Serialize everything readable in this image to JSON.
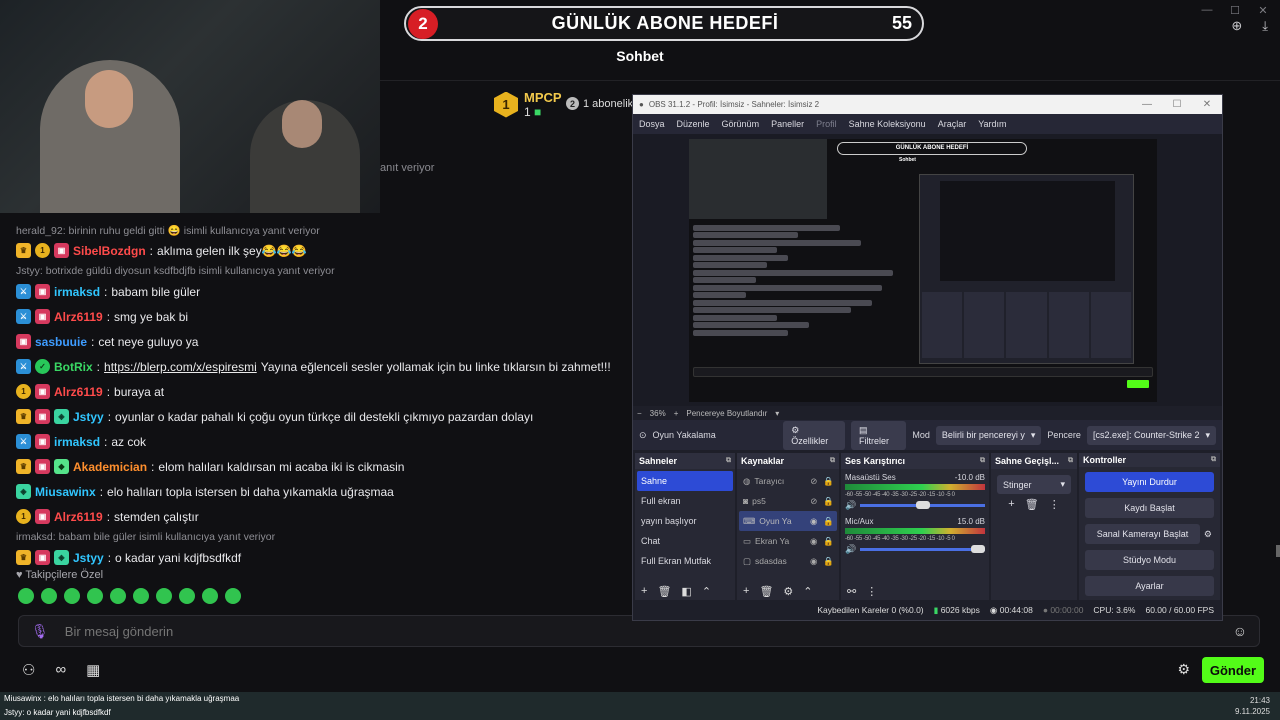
{
  "goal": {
    "badge": "2",
    "title": "GÜNLÜK ABONE HEDEFİ",
    "count": "55"
  },
  "chat_header": "Sohbet",
  "leaderboard": {
    "rank1": "1",
    "rank1_name": "MPCP",
    "rank1_count": "1",
    "rank2": "2",
    "rank2_text": "1 abonelik"
  },
  "partial_reply_text": "anıt veriyor",
  "chat": [
    {
      "type": "reply",
      "text": "herald_92: birinin ruhu geldi gitti 😄 isimli kullanıcıya yanıt veriyor"
    },
    {
      "badges": [
        "crown",
        "gold1",
        "mod"
      ],
      "name": "SibelBozdgn",
      "color": "n-red",
      "text": "aklıma gelen ilk şey😂😂😂"
    },
    {
      "type": "reply",
      "text": "Jstyy: botrixde güldü diyosun ksdfbdjfb isimli kullanıcıya yanıt veriyor"
    },
    {
      "badges": [
        "bot",
        "mod"
      ],
      "name": "irmaksd",
      "color": "n-cyan",
      "text": "babam bile güler"
    },
    {
      "badges": [
        "bot",
        "mod"
      ],
      "name": "Alrz6119",
      "color": "n-red",
      "text": "smg ye bak bi"
    },
    {
      "badges": [
        "mod"
      ],
      "name": "sasbuuie",
      "color": "n-blue",
      "text": "cet neye guluyo ya"
    },
    {
      "badges": [
        "bot",
        "green"
      ],
      "name": "BotRix",
      "color": "n-green",
      "link": "https://blerp.com/x/espiresmi",
      "text": "Yayına eğlenceli sesler yollamak için bu linke tıklarsın bi zahmet!!!"
    },
    {
      "badges": [
        "gold1",
        "mod"
      ],
      "name": "Alrz6119",
      "color": "n-red",
      "text": "buraya at"
    },
    {
      "badges": [
        "crown",
        "mod",
        "gift"
      ],
      "name": "Jstyy",
      "color": "n-cyan",
      "text": "oyunlar o kadar pahalı ki çoğu oyun türkçe dil destekli çıkmıyo pazardan dolayı"
    },
    {
      "badges": [
        "bot",
        "mod"
      ],
      "name": "irmaksd",
      "color": "n-cyan",
      "text": "az cok"
    },
    {
      "badges": [
        "crown",
        "mod",
        "pix"
      ],
      "name": "Akademician",
      "color": "n-orange",
      "text": "elom halıları kaldırsan mi acaba iki is cikmasin"
    },
    {
      "badges": [
        "gift"
      ],
      "name": "Miusawinx",
      "color": "n-cyan",
      "text": "elo halıları topla istersen bi daha yıkamakla uğraşmaa"
    },
    {
      "badges": [
        "gold1",
        "mod"
      ],
      "name": "Alrz6119",
      "color": "n-red",
      "text": "stemden çalıştır"
    },
    {
      "type": "reply",
      "text": "irmaksd: babam bile güler isimli kullanıcıya yanıt veriyor"
    },
    {
      "badges": [
        "crown",
        "mod",
        "gift"
      ],
      "name": "Jstyy",
      "color": "n-cyan",
      "text": "o kadar yani kdjfbsdfkdf"
    }
  ],
  "followers_label": "Takipçilere Özel",
  "input": {
    "placeholder": "Bir mesaj gönderin"
  },
  "send_label": "Gönder",
  "ticker": {
    "line1": "Miusawinx : elo halıları topla istersen bi daha yıkamakla uğraşmaa",
    "line2": "Jstyy: o kadar yani kdjfbsdfkdf"
  },
  "clock": {
    "time": "21:43",
    "date": "9.11.2025"
  },
  "obs": {
    "title": "OBS 31.1.2 - Profil: İsimsiz - Sahneler: İsimsiz 2",
    "menu": [
      "Dosya",
      "Düzenle",
      "Görünüm",
      "Paneller",
      "Profil",
      "Sahne Koleksiyonu",
      "Araçlar",
      "Yardım"
    ],
    "nested_goal": "GÜNLÜK ABONE HEDEFİ",
    "nested_sohbet": "Sohbet",
    "zoom": "36%",
    "fit_label": "Pencereye Boyutlandır",
    "context": {
      "source": "Oyun Yakalama",
      "props": "Özellikler",
      "filters": "Filtreler",
      "mode_label": "Mod",
      "mode_value": "Belirli bir pencereyi y",
      "window_label": "Pencere",
      "window_value": "[cs2.exe]: Counter-Strike 2"
    },
    "docks": {
      "scenes": "Sahneler",
      "sources": "Kaynaklar",
      "mixer": "Ses Karıştırıcı",
      "transitions": "Sahne Geçişl...",
      "controls": "Kontroller"
    },
    "scenes": [
      "Sahne",
      "Full ekran",
      "yayın başlıyor",
      "Chat",
      "Full Ekran Mutfak"
    ],
    "sources": [
      "Tarayıcı",
      "ps5",
      "Oyun Ya",
      "Ekran Ya",
      "sdasdas"
    ],
    "mixer": [
      {
        "name": "Masaüstü Ses",
        "db": "-10.0 dB",
        "ticks": "-60 -55 -50 -45 -40 -35 -30 -25 -20 -15 -10 -5 0",
        "level": 0.5
      },
      {
        "name": "Mic/Aux",
        "db": "15.0 dB",
        "ticks": "-60 -55 -50 -45 -40 -35 -30 -25 -20 -15 -10 -5 0",
        "level": 1.0
      }
    ],
    "transition": "Stinger",
    "controls": [
      "Yayını Durdur",
      "Kaydı Başlat",
      "Sanal Kamerayı Başlat",
      "Stüdyo Modu",
      "Ayarlar"
    ],
    "status": {
      "dropped": "Kaybedilen Kareler 0 (%0.0)",
      "kbps": "6026 kbps",
      "stream_time": "00:44:08",
      "rec_time": "00:00:00",
      "cpu": "CPU: 3.6%",
      "fps": "60.00 / 60.00 FPS"
    }
  }
}
